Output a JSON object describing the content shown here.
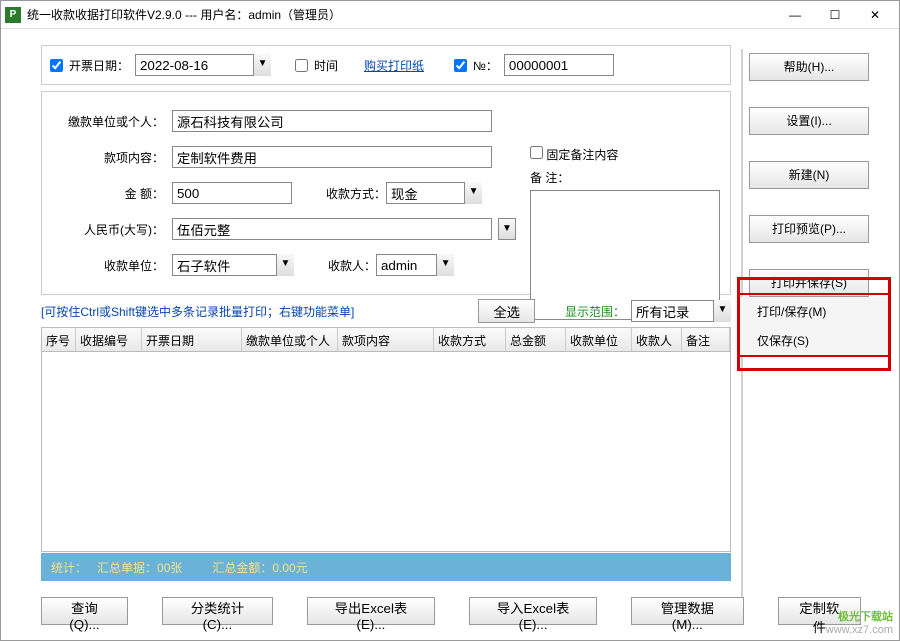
{
  "titlebar": {
    "title": "统一收款收据打印软件V2.9.0 --- 用户名：admin（管理员）"
  },
  "toprow": {
    "kprq_label": "开票日期：",
    "kprq_value": "2022-08-16",
    "time_label": "时间",
    "buy_paper": "购买打印纸",
    "no_label": "№：",
    "no_value": "00000001"
  },
  "form": {
    "payer_label": "缴款单位或个人：",
    "payer_value": "源石科技有限公司",
    "content_label": "款项内容：",
    "content_value": "定制软件费用",
    "amount_label": "金        额：",
    "amount_value": "500",
    "paytype_label": "收款方式：",
    "paytype_value": "现金",
    "rmb_label": "人民币(大写)：",
    "rmb_value": "伍佰元整",
    "unit_label": "收款单位：",
    "unit_value": "石子软件",
    "skr_label": "收款人：",
    "skr_value": "admin",
    "fix_remark_label": "固定备注内容",
    "remark_label": "备 注："
  },
  "mid": {
    "hint": "[可按住Ctrl或Shift键选中多条记录批量打印；右键功能菜单]",
    "selectall": "全选",
    "range_label": "显示范围：",
    "range_value": "所有记录"
  },
  "table": {
    "cols": [
      "序号",
      "收据编号",
      "开票日期",
      "缴款单位或个人",
      "款项内容",
      "收款方式",
      "总金额",
      "收款单位",
      "收款人",
      "备注"
    ]
  },
  "status": {
    "t1": "统计：",
    "t2": "汇总单据：00张",
    "t3": "汇总金额：0.00元"
  },
  "sidebar": {
    "help": "帮助(H)...",
    "settings": "设置(I)...",
    "new": "新建(N)",
    "preview": "打印预览(P)...",
    "printsave": "打印并保存(S)",
    "menu1": "打印/保存(M)",
    "menu2": "仅保存(S)"
  },
  "bottom": {
    "query": "查询(Q)...",
    "stat": "分类统计(C)...",
    "exp": "导出Excel表(E)...",
    "imp": "导入Excel表(E)...",
    "data": "管理数据(M)...",
    "cust": "定制软件"
  },
  "watermark": {
    "brand": "极光下载站",
    "url": "www.xz7.com"
  }
}
